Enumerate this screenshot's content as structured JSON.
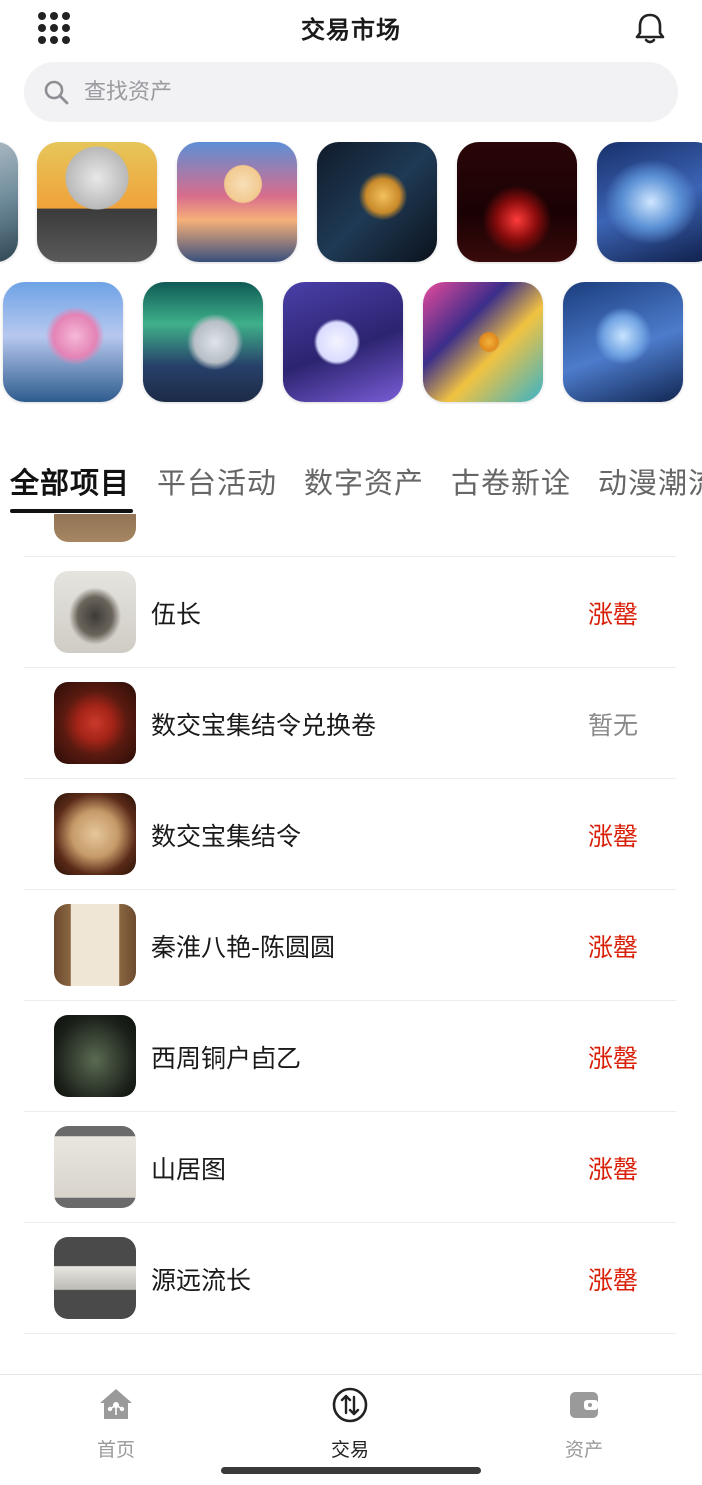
{
  "header": {
    "title": "交易市场",
    "menu_icon": "grid-menu-icon",
    "bell_icon": "bell-icon"
  },
  "search": {
    "placeholder": "查找资产",
    "icon": "search-icon"
  },
  "tabs": [
    {
      "label": "全部项目",
      "active": true
    },
    {
      "label": "平台活动",
      "active": false
    },
    {
      "label": "数字资产",
      "active": false
    },
    {
      "label": "古卷新诠",
      "active": false
    },
    {
      "label": "动漫潮流",
      "active": false
    }
  ],
  "list": {
    "items": [
      {
        "name": "伍长",
        "status": "涨罄"
      },
      {
        "name": "数交宝集结令兑换卷",
        "status": "暂无"
      },
      {
        "name": "数交宝集结令",
        "status": "涨罄"
      },
      {
        "name": "秦淮八艳-陈圆圆",
        "status": "涨罄"
      },
      {
        "name": "西周铜户卣乙",
        "status": "涨罄"
      },
      {
        "name": "山居图",
        "status": "涨罄"
      },
      {
        "name": "源远流长",
        "status": "涨罄"
      }
    ]
  },
  "tabbar": {
    "items": [
      {
        "label": "首页",
        "icon": "home-icon",
        "active": false
      },
      {
        "label": "交易",
        "icon": "trade-exchange-icon",
        "active": true
      },
      {
        "label": "资产",
        "icon": "wallet-icon",
        "active": false
      }
    ]
  },
  "colors": {
    "sold_out": "#d81e06",
    "none": "#8a8a8a",
    "search_bg": "#f2f2f4"
  }
}
